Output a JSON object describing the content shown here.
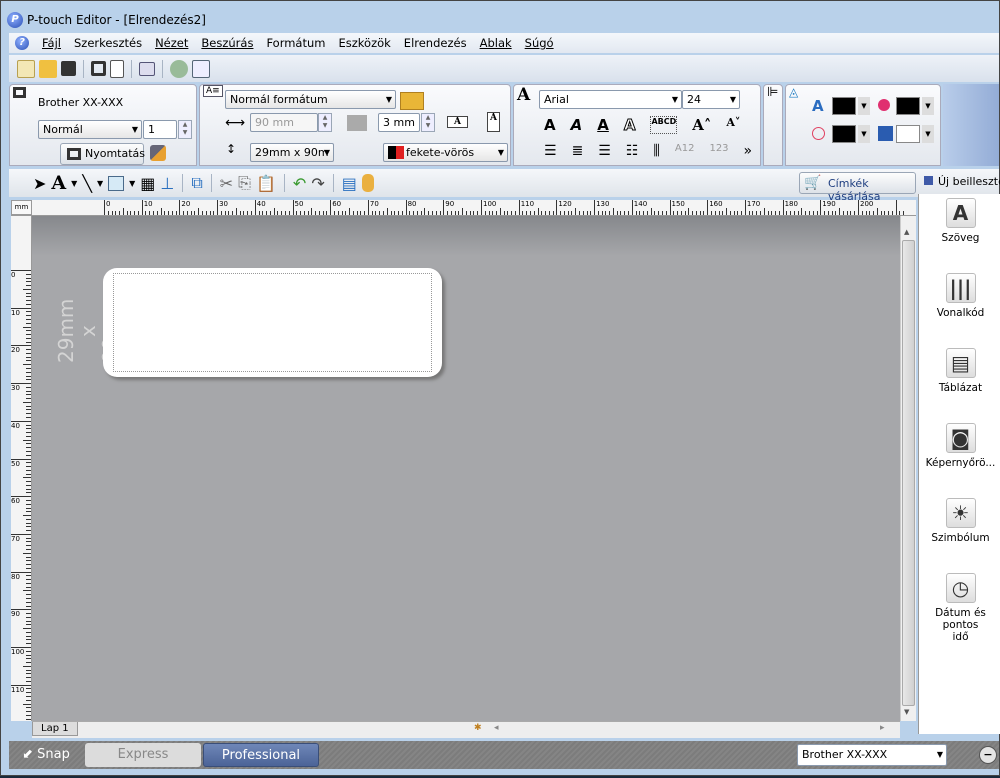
{
  "window": {
    "title": "P-touch Editor - [Elrendezés2]"
  },
  "menu": [
    "Fájl",
    "Szerkesztés",
    "Nézet",
    "Beszúrás",
    "Formátum",
    "Eszközök",
    "Elrendezés",
    "Ablak",
    "Súgó"
  ],
  "printer_panel": {
    "printer": "Brother XX-XXX",
    "mode": "Normál",
    "copies": "1",
    "print_label": "Nyomtatás"
  },
  "layout_panel": {
    "format": "Normál formátum",
    "length": "90 mm",
    "margin": "3 mm",
    "media": "29mm x 90m",
    "color": "fekete-vörös"
  },
  "font_panel": {
    "font": "Arial",
    "size": "24",
    "more": "»"
  },
  "color_panel": {
    "text_color": "#000000",
    "fill_color": "#000000",
    "line_color": "#000000",
    "bg_color": "#ffffff"
  },
  "draw_toolbar": {
    "buy_labels": "Címkék vásárlása"
  },
  "ruler": {
    "unit": "mm",
    "h_labels": [
      "0",
      "10",
      "20",
      "30",
      "40",
      "50",
      "60",
      "70",
      "80",
      "90",
      "100",
      "110",
      "120",
      "130",
      "140",
      "150",
      "160",
      "170",
      "180",
      "190",
      "200"
    ],
    "v_labels": [
      "0",
      "10",
      "20",
      "30",
      "40",
      "50",
      "60",
      "70",
      "80",
      "90",
      "100",
      "110"
    ]
  },
  "canvas": {
    "size_line1": "29mm",
    "size_line2": "x 90mm"
  },
  "side_panel": {
    "header": "Új beillesztése",
    "items": [
      {
        "label": "Szöveg",
        "icon": "text-icon"
      },
      {
        "label": "Vonalkód",
        "icon": "barcode-icon"
      },
      {
        "label": "Táblázat",
        "icon": "table-icon"
      },
      {
        "label": "Képernyőrö...",
        "icon": "screen-capture-icon"
      },
      {
        "label": "Szimbólum",
        "icon": "symbol-icon"
      },
      {
        "label": "Dátum és pontos idő",
        "icon": "clock-icon"
      }
    ]
  },
  "sheet_tab": "Lap 1",
  "bottom": {
    "snap": "Snap",
    "express": "Express",
    "professional": "Professional",
    "printer": "Brother XX-XXX"
  }
}
